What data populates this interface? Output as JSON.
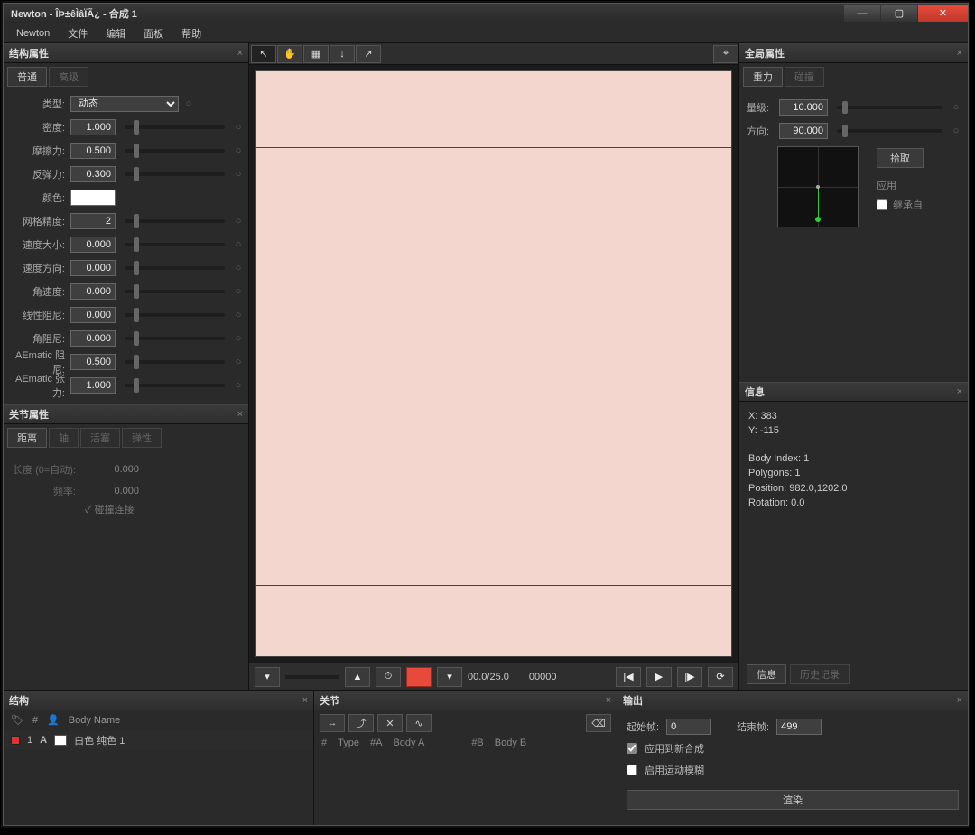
{
  "title": "Newton - ÎÞ±êÌâÏÃ¿ - 合成 1",
  "menu": [
    "Newton",
    "文件",
    "编辑",
    "面板",
    "帮助"
  ],
  "struct_props": {
    "title": "结构属性",
    "tabs": [
      "普通",
      "高级"
    ],
    "type_label": "类型:",
    "type_value": "动态",
    "rows": [
      {
        "label": "密度:",
        "value": "1.000"
      },
      {
        "label": "摩擦力:",
        "value": "0.500"
      },
      {
        "label": "反弹力:",
        "value": "0.300"
      }
    ],
    "color_label": "颜色:",
    "mesh_label": "网格精度:",
    "mesh_value": "2",
    "more": [
      {
        "label": "速度大小:",
        "value": "0.000"
      },
      {
        "label": "速度方向:",
        "value": "0.000"
      },
      {
        "label": "角速度:",
        "value": "0.000"
      },
      {
        "label": "线性阻尼:",
        "value": "0.000"
      },
      {
        "label": "角阻尼:",
        "value": "0.000"
      },
      {
        "label": "AEmatic 阻尼:",
        "value": "0.500"
      },
      {
        "label": "AEmatic 张力:",
        "value": "1.000"
      }
    ]
  },
  "joint_props": {
    "title": "关节属性",
    "tabs": [
      "距离",
      "轴",
      "活塞",
      "弹性"
    ],
    "rows": [
      {
        "label": "长度 (0=自动):",
        "value": "0.000"
      },
      {
        "label": "频率:",
        "value": "0.000"
      }
    ],
    "collide": "碰撞连接"
  },
  "viewport_tools": [
    "pointer",
    "hand",
    "grid",
    "down",
    "out",
    "snap"
  ],
  "timeline": {
    "fps": "00.0/25.0",
    "frame": "00000"
  },
  "global": {
    "title": "全局属性",
    "tabs": [
      "重力",
      "碰撞"
    ],
    "scale_label": "量级:",
    "scale_value": "10.000",
    "dir_label": "方向:",
    "dir_value": "90.000",
    "pick": "拾取",
    "apply": "应用",
    "inherit": "继承自:"
  },
  "info": {
    "title": "信息",
    "x": "X: 383",
    "y": "Y: -115",
    "body_index": "Body Index: 1",
    "polygons": "Polygons: 1",
    "position": "Position: 982.0,1202.0",
    "rotation": "Rotation: 0.0",
    "tabs": [
      "信息",
      "历史记录"
    ]
  },
  "bottom": {
    "struct": {
      "title": "结构",
      "cols": [
        "#",
        "",
        "Body Name"
      ],
      "row_index": "1",
      "row_a": "A",
      "row_name": "白色 纯色 1"
    },
    "joints": {
      "title": "关节",
      "cols": [
        "#",
        "Type",
        "#A",
        "Body A",
        "#B",
        "Body B"
      ]
    },
    "output": {
      "title": "输出",
      "start_label": "起始帧:",
      "start": "0",
      "end_label": "结束帧:",
      "end": "499",
      "apply": "应用到新合成",
      "motion": "启用运动模糊",
      "render": "渲染"
    }
  }
}
